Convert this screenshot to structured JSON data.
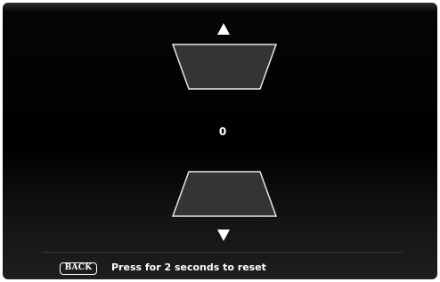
{
  "controls": {
    "increase_icon": "triangle-up-icon",
    "decrease_icon": "triangle-down-icon"
  },
  "display": {
    "value": "0"
  },
  "footer": {
    "back_label": "BACK",
    "hint": "Press for 2 seconds to reset"
  },
  "colors": {
    "background": "#000000",
    "text": "#ffffff",
    "button_fill": "#333333",
    "button_border": "#ffffff"
  }
}
